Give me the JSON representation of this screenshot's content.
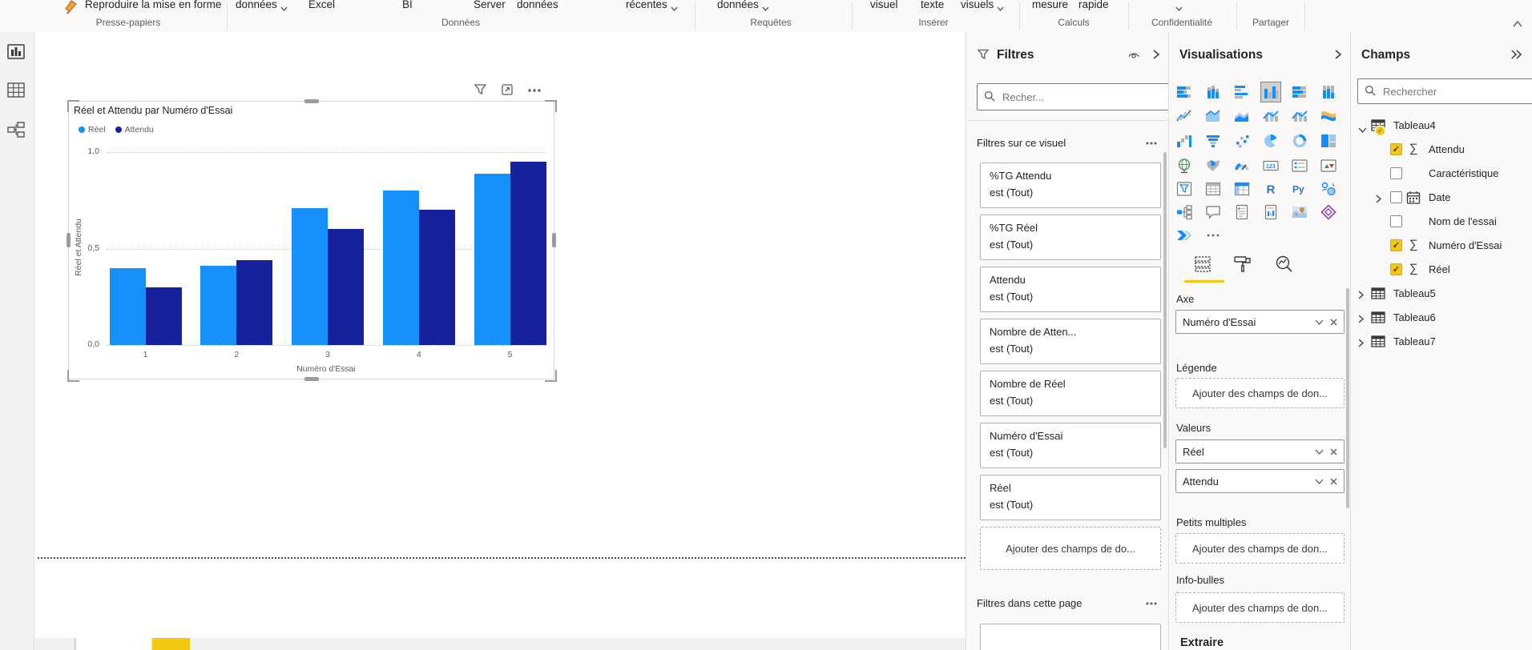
{
  "app": {
    "colors": {
      "accent_yellow": "#F2C811",
      "series_blue": "#1890FB",
      "series_navy": "#16219B",
      "icon_blue": "#118DFF"
    }
  },
  "ribbon": {
    "buttons": [
      {
        "label": "Reproduire la mise en forme",
        "icon": "format-painter-icon",
        "chevron": false
      },
      {
        "label": "données",
        "chevron": true
      },
      {
        "label": "Excel",
        "chevron": false
      },
      {
        "label": "BI",
        "chevron": false
      },
      {
        "label": "Server",
        "chevron": false
      },
      {
        "label": "données",
        "chevron": false
      },
      {
        "label": "récentes",
        "chevron": true
      },
      {
        "label": "données",
        "chevron": true
      },
      {
        "label": "visuel",
        "chevron": false
      },
      {
        "label": "texte",
        "chevron": false
      },
      {
        "label": "visuels",
        "chevron": true
      },
      {
        "label": "mesure",
        "chevron": false
      },
      {
        "label": "rapide",
        "chevron": false
      },
      {
        "label": "",
        "chevron": true
      }
    ],
    "groups": [
      "Presse-papiers",
      "Données",
      "Requêtes",
      "Insérer",
      "Calculs",
      "Confidentialité",
      "Partager"
    ],
    "collapse_icon": "chevron-up-icon"
  },
  "sidebar": {
    "views": [
      {
        "name": "report-view-icon"
      },
      {
        "name": "data-view-icon"
      },
      {
        "name": "model-view-icon"
      }
    ]
  },
  "visual": {
    "title": "Réel et Attendu par Numéro d'Essai",
    "header_icons": [
      "filter-icon",
      "focus-mode-icon",
      "more-options-icon"
    ]
  },
  "chart_data": {
    "type": "bar",
    "title": "Réel et Attendu par Numéro d'Essai",
    "categories": [
      "1",
      "2",
      "3",
      "4",
      "5"
    ],
    "series": [
      {
        "name": "Réel",
        "color": "#1890FB",
        "values": [
          0.4,
          0.41,
          0.71,
          0.8,
          0.89
        ]
      },
      {
        "name": "Attendu",
        "color": "#16219B",
        "values": [
          0.3,
          0.44,
          0.6,
          0.7,
          0.95
        ]
      }
    ],
    "xlabel": "Numéro d'Essai",
    "ylabel": "Réel et Attendu",
    "ylim": [
      0,
      1.0
    ],
    "yticks": [
      {
        "value": 0,
        "label": "0,0"
      },
      {
        "value": 0.5,
        "label": "0,5"
      },
      {
        "value": 1,
        "label": "1,0"
      }
    ],
    "grid": "horizontal-dotted",
    "legend_position": "top-left"
  },
  "filters_pane": {
    "title": "Filtres",
    "header_icons": [
      "funnel-icon",
      "eye-icon",
      "collapse-pane-icon"
    ],
    "search_placeholder": "Recher...",
    "section_visual": {
      "label": "Filtres sur ce visuel",
      "more_icon": "more-options-icon"
    },
    "cards": [
      {
        "field": "%TG Attendu",
        "condition": "est (Tout)"
      },
      {
        "field": "%TG Réel",
        "condition": "est (Tout)"
      },
      {
        "field": "Attendu",
        "condition": "est (Tout)"
      },
      {
        "field": "Nombre de Atten...",
        "condition": "est (Tout)"
      },
      {
        "field": "Nombre de Réel",
        "condition": "est (Tout)"
      },
      {
        "field": "Numéro d'Essai",
        "condition": "est (Tout)"
      },
      {
        "field": "Réel",
        "condition": "est (Tout)"
      }
    ],
    "add_fields_label": "Ajouter des champs de do...",
    "section_page": {
      "label": "Filtres dans cette page",
      "more_icon": "more-options-icon"
    }
  },
  "viz_pane": {
    "title": "Visualisations",
    "collapse_icon": "collapse-pane-icon",
    "icons": [
      {
        "name": "stacked-bar-chart",
        "glyph": "barsH"
      },
      {
        "name": "stacked-column-chart",
        "glyph": "barsV"
      },
      {
        "name": "clustered-bar-chart",
        "glyph": "barsH2"
      },
      {
        "name": "clustered-column-chart",
        "glyph": "barsV2"
      },
      {
        "name": "100-stacked-bar-chart",
        "glyph": "barsH3"
      },
      {
        "name": "100-stacked-column-chart",
        "glyph": "barsV3"
      },
      {
        "name": "line-chart",
        "glyph": "line"
      },
      {
        "name": "area-chart",
        "glyph": "area"
      },
      {
        "name": "stacked-area-chart",
        "glyph": "area2"
      },
      {
        "name": "line-stacked-column-chart",
        "glyph": "combo1"
      },
      {
        "name": "line-clustered-column-chart",
        "glyph": "combo1"
      },
      {
        "name": "ribbon-chart",
        "glyph": "ribbon"
      },
      {
        "name": "waterfall-chart",
        "glyph": "waterfall"
      },
      {
        "name": "funnel-chart",
        "glyph": "funnelCh"
      },
      {
        "name": "scatter-chart",
        "glyph": "scatter"
      },
      {
        "name": "pie-chart",
        "glyph": "pie"
      },
      {
        "name": "donut-chart",
        "glyph": "donut"
      },
      {
        "name": "treemap",
        "glyph": "treemap"
      },
      {
        "name": "map",
        "glyph": "globe"
      },
      {
        "name": "filled-map",
        "glyph": "mapShape"
      },
      {
        "name": "gauge",
        "glyph": "gauge"
      },
      {
        "name": "card",
        "glyph": "card123"
      },
      {
        "name": "multi-row-card",
        "glyph": "multirow"
      },
      {
        "name": "kpi",
        "glyph": "kpi"
      },
      {
        "name": "slicer",
        "glyph": "slicer"
      },
      {
        "name": "table",
        "glyph": "tableGrid"
      },
      {
        "name": "matrix",
        "glyph": "matrixGrid"
      },
      {
        "name": "r-script-visual",
        "glyph": "Rletter"
      },
      {
        "name": "python-visual",
        "glyph": "PyLetters"
      },
      {
        "name": "key-influencers",
        "glyph": "keyInfl"
      },
      {
        "name": "decomposition-tree",
        "glyph": "decomp"
      },
      {
        "name": "q-and-a",
        "glyph": "qa"
      },
      {
        "name": "smart-narrative",
        "glyph": "narrative"
      },
      {
        "name": "paginated-report",
        "glyph": "paginated"
      },
      {
        "name": "arcgis-map",
        "glyph": "arcgis"
      },
      {
        "name": "power-apps",
        "glyph": "powerapps"
      },
      {
        "name": "power-automate",
        "glyph": "automate"
      },
      {
        "name": "get-more-visuals",
        "glyph": "dots"
      }
    ],
    "selected_icon_index": 3,
    "tabs": [
      {
        "name": "tab-fields",
        "icon": "fields-tab-icon",
        "active": true
      },
      {
        "name": "tab-format",
        "icon": "format-tab-icon",
        "active": false
      },
      {
        "name": "tab-analytics",
        "icon": "analytics-tab-icon",
        "active": false
      }
    ],
    "wells": [
      {
        "label": "Axe",
        "chips": [
          "Numéro d'Essai"
        ],
        "placeholder": ""
      },
      {
        "label": "Légende",
        "chips": [],
        "placeholder": "Ajouter des champs de don..."
      },
      {
        "label": "Valeurs",
        "chips": [
          "Réel",
          "Attendu"
        ],
        "placeholder": ""
      },
      {
        "label": "Petits multiples",
        "chips": [],
        "placeholder": "Ajouter des champs de don..."
      },
      {
        "label": "Info-bulles",
        "chips": [],
        "placeholder": "Ajouter des champs de don..."
      }
    ],
    "chip_icons": [
      "chevron-down-icon",
      "remove-icon"
    ],
    "drillthrough_label": "Extraire"
  },
  "fields_pane": {
    "title": "Champs",
    "collapse_icon": "double-chevron-right-icon",
    "search_placeholder": "Rechercher",
    "tree": [
      {
        "label": "Tableau4",
        "kind": "table",
        "expanded": true,
        "badge": true
      },
      {
        "label": "Attendu",
        "kind": "field",
        "icon": "sigma-icon",
        "checked": true
      },
      {
        "label": "Caractéristique",
        "kind": "field",
        "icon": null,
        "checked": false
      },
      {
        "label": "Date",
        "kind": "field",
        "icon": "calendar-icon",
        "checked": false,
        "expandable": true
      },
      {
        "label": "Nom de l'essai",
        "kind": "field",
        "icon": null,
        "checked": false
      },
      {
        "label": "Numéro d'Essai",
        "kind": "field",
        "icon": "sigma-icon",
        "checked": true
      },
      {
        "label": "Réel",
        "kind": "field",
        "icon": "sigma-icon",
        "checked": true
      },
      {
        "label": "Tableau5",
        "kind": "table",
        "expanded": false,
        "badge": false
      },
      {
        "label": "Tableau6",
        "kind": "table",
        "expanded": false,
        "badge": false
      },
      {
        "label": "Tableau7",
        "kind": "table",
        "expanded": false,
        "badge": false
      }
    ]
  },
  "page_tabs": {
    "active_tab_color": "#ffffff",
    "highlight_tab_color": "#F2C811"
  }
}
